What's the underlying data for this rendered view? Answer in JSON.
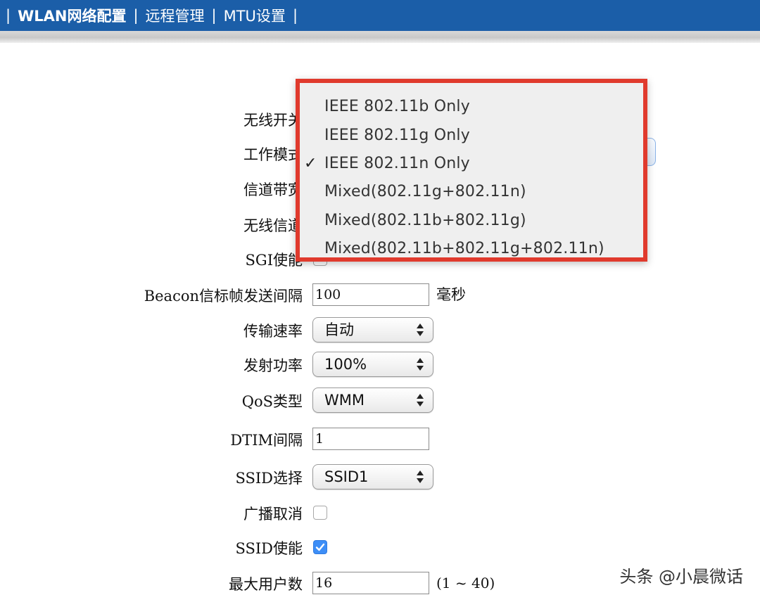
{
  "nav": {
    "sep": "|",
    "items": [
      "WLAN网络配置",
      "远程管理",
      "MTU设置"
    ]
  },
  "form": {
    "wireless_switch_label": "无线开关",
    "work_mode_label": "工作模式",
    "channel_bandwidth_label": "信道带宽",
    "wireless_channel_label": "无线信道",
    "sgi_label": "SGI使能",
    "beacon_label": "Beacon信标帧发送间隔",
    "beacon_value": "100",
    "beacon_unit": "毫秒",
    "tx_rate_label": "传输速率",
    "tx_rate_value": "自动",
    "tx_power_label": "发射功率",
    "tx_power_value": "100%",
    "qos_label": "QoS类型",
    "qos_value": "WMM",
    "dtim_label": "DTIM间隔",
    "dtim_value": "1",
    "ssid_select_label": "SSID选择",
    "ssid_select_value": "SSID1",
    "broadcast_cancel_label": "广播取消",
    "broadcast_cancel_checked": false,
    "ssid_enable_label": "SSID使能",
    "ssid_enable_checked": true,
    "max_users_label": "最大用户数",
    "max_users_value": "16",
    "max_users_range": "(1 ~ 40)"
  },
  "dropdown": {
    "checkmark": "✓",
    "selected_index": 2,
    "options": [
      "IEEE 802.11b Only",
      "IEEE 802.11g Only",
      "IEEE 802.11n Only",
      "Mixed(802.11g+802.11n)",
      "Mixed(802.11b+802.11g)",
      "Mixed(802.11b+802.11g+802.11n)"
    ]
  },
  "watermark": "头条 @小晨微话",
  "colors": {
    "nav_bg": "#1b5ea8",
    "highlight_border": "#e03a2d",
    "checkbox_checked": "#3d8ef7"
  }
}
